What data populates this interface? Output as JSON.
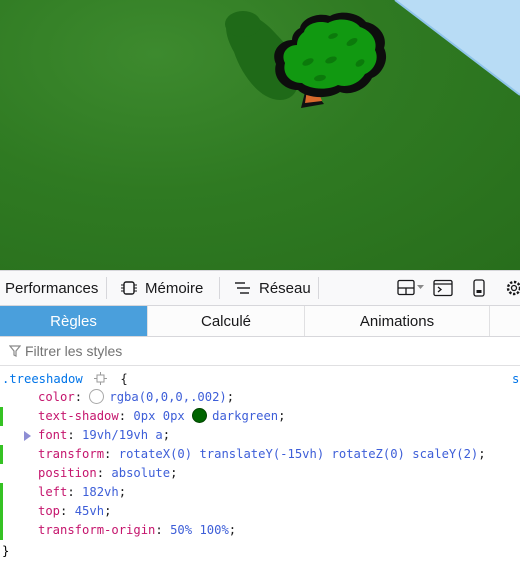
{
  "viewport": {
    "ground_color": "#2f7a22",
    "sky_color": "#b8dcf5",
    "tree_color": "#119911",
    "trunk_color": "#d96a2c",
    "shadow_color": "#1f6a18"
  },
  "toolbar": {
    "tabs": [
      {
        "label": "Performances"
      },
      {
        "label": "Mémoire",
        "icon": "memory-chip-icon"
      },
      {
        "label": "Réseau",
        "icon": "network-icon"
      }
    ],
    "icons": [
      "split-console-icon",
      "frame-picker-icon",
      "responsive-mode-icon",
      "settings-gear-icon"
    ]
  },
  "subtabs": [
    {
      "label": "Règles",
      "active": true
    },
    {
      "label": "Calculé",
      "active": false
    },
    {
      "label": "Animations",
      "active": false
    }
  ],
  "filter": {
    "placeholder": "Filtrer les styles",
    "icon": "filter-icon"
  },
  "rule": {
    "selector": ".treeshadow",
    "open_brace": "{",
    "close_brace": "}",
    "source": "s",
    "declarations": [
      {
        "name": "color",
        "value": "rgba(0,0,0,.002)",
        "swatch": "rgba(0,0,0,0.002)",
        "changed": false
      },
      {
        "name": "text-shadow",
        "value_prefix": "0px 0px ",
        "value": "darkgreen",
        "swatch": "#006400",
        "changed": true
      },
      {
        "name": "font",
        "value": "19vh/19vh a",
        "expandable": true,
        "changed": false
      },
      {
        "name": "transform",
        "value": "rotateX(0) translateY(-15vh) rotateZ(0) scaleY(2)",
        "changed": true
      },
      {
        "name": "position",
        "value": "absolute",
        "changed": false
      },
      {
        "name": "left",
        "value": "182vh",
        "changed": true
      },
      {
        "name": "top",
        "value": "45vh",
        "changed": true
      },
      {
        "name": "transform-origin",
        "value": "50% 100%",
        "changed": true
      }
    ]
  }
}
